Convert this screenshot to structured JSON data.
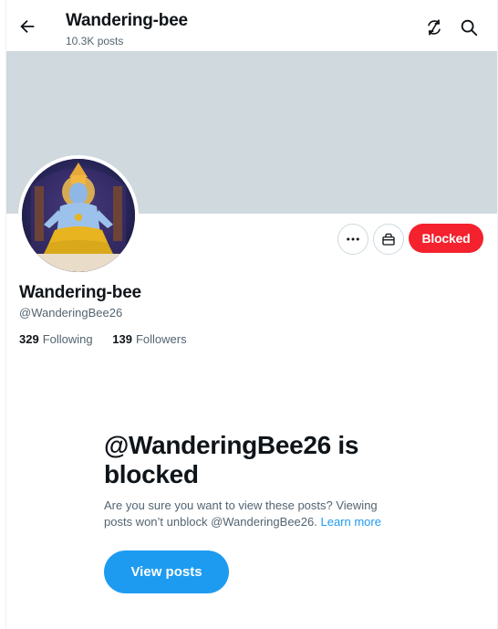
{
  "header": {
    "title": "Wandering-bee",
    "posts_count": "10.3K posts"
  },
  "profile": {
    "display_name": "Wandering-bee",
    "handle": "@WanderingBee26",
    "following_count": "329",
    "following_label": "Following",
    "followers_count": "139",
    "followers_label": "Followers"
  },
  "actions": {
    "blocked_label": "Blocked"
  },
  "blocked_notice": {
    "title": "@WanderingBee26 is blocked",
    "message": "Are you sure you want to view these posts? Viewing posts won’t unblock @WanderingBee26.",
    "learn_more": "Learn more",
    "view_posts_label": "View posts"
  },
  "colors": {
    "accent": "#1d9bf0",
    "blocked": "#f4212e",
    "banner": "#cfd9de"
  },
  "icons": [
    "back-arrow-icon",
    "refresh-icon",
    "search-icon",
    "more-icon",
    "gift-icon"
  ]
}
